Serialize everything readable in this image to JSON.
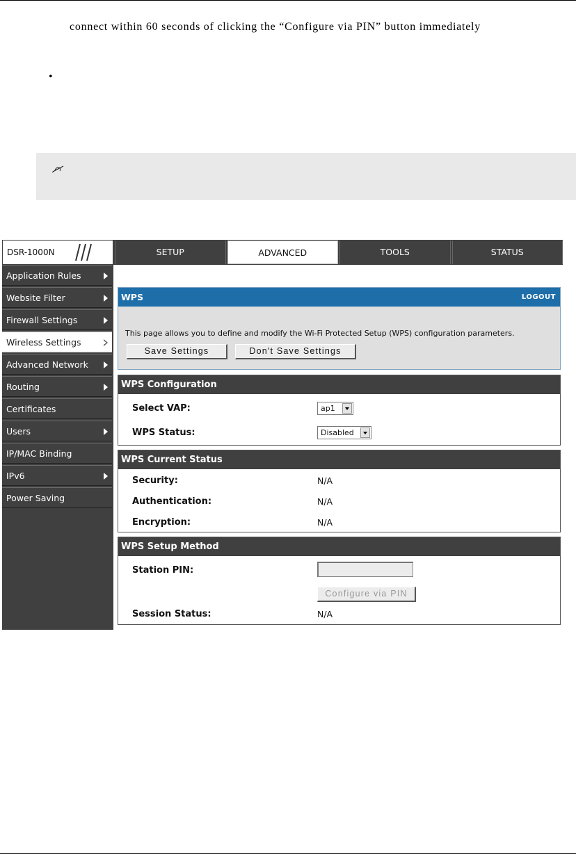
{
  "document": {
    "paragraph": "connect within 60 seconds of clicking the “Configure via PIN” button immediately"
  },
  "router": {
    "brand": "DSR-1000N",
    "nav": [
      {
        "label": "SETUP",
        "active": false
      },
      {
        "label": "ADVANCED",
        "active": true
      },
      {
        "label": "TOOLS",
        "active": false
      },
      {
        "label": "STATUS",
        "active": false
      }
    ],
    "sidebar": [
      {
        "label": "Application Rules",
        "arrow": "solid"
      },
      {
        "label": "Website Filter",
        "arrow": "solid"
      },
      {
        "label": "Firewall Settings",
        "arrow": "solid"
      },
      {
        "label": "Wireless Settings",
        "arrow": "hollow",
        "active": true
      },
      {
        "label": "Advanced Network",
        "arrow": "solid"
      },
      {
        "label": "Routing",
        "arrow": "solid"
      },
      {
        "label": "Certificates",
        "arrow": "none"
      },
      {
        "label": "Users",
        "arrow": "solid"
      },
      {
        "label": "IP/MAC Binding",
        "arrow": "none"
      },
      {
        "label": "IPv6",
        "arrow": "solid"
      },
      {
        "label": "Power Saving",
        "arrow": "none"
      }
    ],
    "wps": {
      "title": "WPS",
      "logout": "LOGOUT",
      "description": "This page allows you to define and modify the Wi-Fi Protected Setup (WPS) configuration parameters.",
      "save_button": "Save Settings",
      "dont_save_button": "Don't Save Settings"
    },
    "config": {
      "title": "WPS Configuration",
      "vap_label": "Select VAP:",
      "vap_value": "ap1",
      "status_label": "WPS Status:",
      "status_value": "Disabled"
    },
    "current": {
      "title": "WPS Current Status",
      "security_label": "Security:",
      "security_value": "N/A",
      "auth_label": "Authentication:",
      "auth_value": "N/A",
      "enc_label": "Encryption:",
      "enc_value": "N/A"
    },
    "setup": {
      "title": "WPS Setup Method",
      "pin_label": "Station PIN:",
      "pin_value": "",
      "configure_button": "Configure via PIN",
      "session_label": "Session Status:",
      "session_value": "N/A"
    },
    "colors": {
      "nav_bg": "#404040",
      "wps_header": "#1e6eaa",
      "panel_bg": "#dfdfdf"
    }
  }
}
